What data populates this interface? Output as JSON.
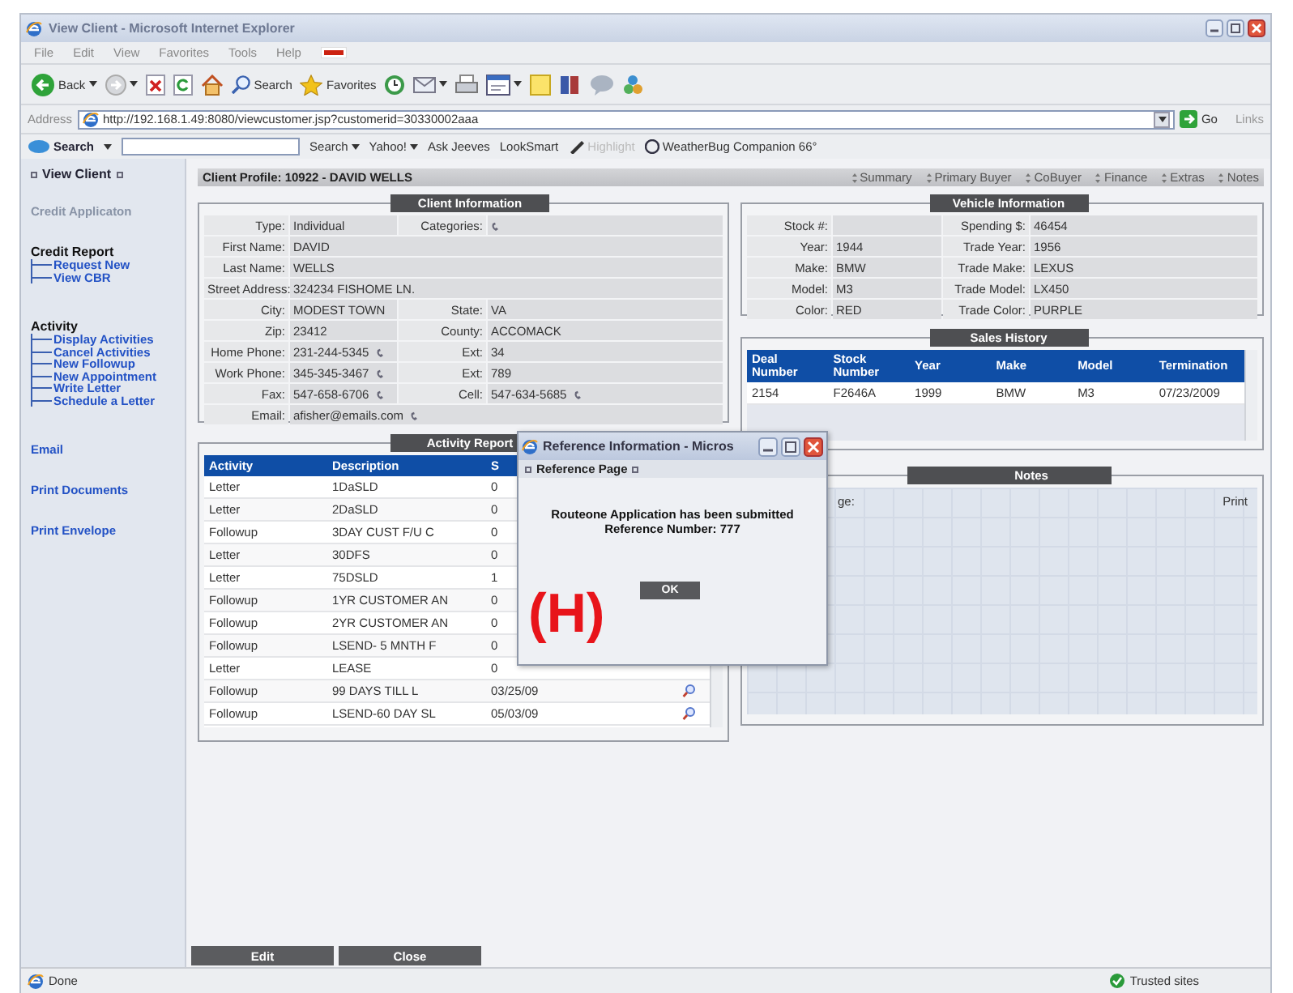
{
  "browser": {
    "title": "View Client - Microsoft Internet Explorer",
    "menu": [
      "File",
      "Edit",
      "View",
      "Favorites",
      "Tools",
      "Help"
    ],
    "toolbar": [
      {
        "kind": "back",
        "label": "Back",
        "dropdown": true
      },
      {
        "kind": "forward",
        "dropdown": true
      },
      {
        "kind": "stop",
        "dropdown": false
      },
      {
        "kind": "refresh",
        "dropdown": false
      },
      {
        "kind": "home",
        "dropdown": false
      },
      {
        "kind": "search",
        "label": "Search",
        "dropdown": false
      },
      {
        "kind": "favorites",
        "label": "Favorites",
        "dropdown": false
      },
      {
        "kind": "history",
        "dropdown": false
      },
      {
        "kind": "mail",
        "dropdown": true
      },
      {
        "kind": "print",
        "dropdown": false
      },
      {
        "kind": "edit",
        "dropdown": true
      },
      {
        "kind": "note",
        "dropdown": false
      },
      {
        "kind": "research",
        "dropdown": false
      },
      {
        "kind": "messenger",
        "dropdown": false
      },
      {
        "kind": "tool",
        "dropdown": false
      }
    ],
    "address_label": "Address",
    "url": "http://192.168.1.49:8080/viewcustomer.jsp?customerid=30330002aaa",
    "go": "Go",
    "links": "Links",
    "search_bar": {
      "brand": "Search",
      "items": [
        {
          "kind": "plain",
          "label": "Search",
          "dropdown": true,
          "disabled": false
        },
        {
          "kind": "plain",
          "label": "Yahoo!",
          "dropdown": true,
          "disabled": false
        },
        {
          "kind": "plain",
          "label": "Ask Jeeves",
          "dropdown": false,
          "disabled": false
        },
        {
          "kind": "plain",
          "label": "LookSmart",
          "dropdown": false,
          "disabled": false
        },
        {
          "kind": "highlight",
          "label": "Highlight",
          "dropdown": false,
          "disabled": true
        },
        {
          "kind": "weather",
          "label": "WeatherBug Companion 66°",
          "dropdown": false,
          "disabled": false
        }
      ]
    }
  },
  "sidebar": {
    "title": "View Client",
    "items": [
      {
        "kind": "muted",
        "label": "Credit Applicaton"
      },
      {
        "kind": "group",
        "label": "Credit Report",
        "children": [
          {
            "label": "Request New"
          },
          {
            "label": "View CBR"
          }
        ]
      },
      {
        "kind": "group",
        "label": "Activity",
        "children": [
          {
            "label": "Display Activities"
          },
          {
            "label": "Cancel Activities"
          },
          {
            "label": "New Followup"
          },
          {
            "label": "New Appointment"
          },
          {
            "label": "Write Letter"
          },
          {
            "label": "Schedule a Letter"
          }
        ]
      },
      {
        "kind": "link",
        "label": "Email"
      },
      {
        "kind": "link",
        "label": "Print Documents"
      },
      {
        "kind": "link",
        "label": "Print Envelope"
      }
    ]
  },
  "profile": {
    "title": "Client Profile: 10922 - DAVID WELLS",
    "tabs": [
      "Summary",
      "Primary Buyer",
      "CoBuyer",
      "Finance",
      "Extras",
      "Notes"
    ]
  },
  "client_info": {
    "legend": "Client Information",
    "rows": [
      [
        {
          "label": "Type:",
          "value": "Individual",
          "icon": false
        },
        {
          "label": "Categories:",
          "icon": true
        }
      ],
      [
        {
          "label": "First Name:",
          "value": "DAVID",
          "icon": false
        }
      ],
      [
        {
          "label": "Last Name:",
          "value": "WELLS",
          "icon": false
        }
      ],
      [
        {
          "label": "Street Address:",
          "value": "324234 FISHOME LN.",
          "icon": false
        }
      ],
      [
        {
          "label": "City:",
          "value": "MODEST TOWN",
          "icon": false
        },
        {
          "label": "State:",
          "value": "VA",
          "icon": false
        }
      ],
      [
        {
          "label": "Zip:",
          "value": "23412",
          "icon": false
        },
        {
          "label": "County:",
          "value": "ACCOMACK",
          "icon": false
        }
      ],
      [
        {
          "label": "Home Phone:",
          "value": "231-244-5345",
          "icon": true
        },
        {
          "label": "Ext:",
          "value": "34",
          "icon": false
        }
      ],
      [
        {
          "label": "Work Phone:",
          "value": "345-345-3467",
          "icon": true
        },
        {
          "label": "Ext:",
          "value": "789",
          "icon": false
        }
      ],
      [
        {
          "label": "Fax:",
          "value": "547-658-6706",
          "icon": true
        },
        {
          "label": "Cell:",
          "value": "547-634-5685",
          "icon": true
        }
      ],
      [
        {
          "label": "Email:",
          "value": "afisher@emails.com",
          "icon": true
        }
      ]
    ]
  },
  "vehicle_info": {
    "legend": "Vehicle Information",
    "rows": [
      [
        {
          "label": "Stock #:"
        },
        {
          "label": "Spending $:",
          "value": "46454"
        }
      ],
      [
        {
          "label": "Year:",
          "value": "1944"
        },
        {
          "label": "Trade Year:",
          "value": "1956"
        }
      ],
      [
        {
          "label": "Make:",
          "value": "BMW"
        },
        {
          "label": "Trade Make:",
          "value": "LEXUS"
        }
      ],
      [
        {
          "label": "Model:",
          "value": "M3"
        },
        {
          "label": "Trade Model:",
          "value": "LX450"
        }
      ],
      [
        {
          "label": "Color:",
          "value": "RED"
        },
        {
          "label": "Trade Color:",
          "value": "PURPLE"
        }
      ]
    ]
  },
  "sales_history": {
    "legend": "Sales History",
    "columns": [
      "Deal Number",
      "Stock Number",
      "Year",
      "Make",
      "Model",
      "Termination"
    ],
    "rows": [
      [
        "2154",
        "F2646A",
        "1999",
        "BMW",
        "M3",
        "07/23/2009"
      ]
    ]
  },
  "activity_report": {
    "legend": "Activity Report",
    "columns": [
      "Activity",
      "Description",
      "S"
    ],
    "rows": [
      {
        "cells": [
          "Letter",
          "1DaSLD",
          "0"
        ]
      },
      {
        "cells": [
          "Letter",
          "2DaSLD",
          "0"
        ]
      },
      {
        "cells": [
          "Followup",
          "3DAY CUST F/U C",
          "0"
        ]
      },
      {
        "cells": [
          "Letter",
          "30DFS",
          "0"
        ]
      },
      {
        "cells": [
          "Letter",
          "75DSLD",
          "1"
        ]
      },
      {
        "cells": [
          "Followup",
          "1YR CUSTOMER AN",
          "0"
        ]
      },
      {
        "cells": [
          "Followup",
          "2YR CUSTOMER AN",
          "0"
        ]
      },
      {
        "cells": [
          "Followup",
          "LSEND- 5 MNTH F",
          "0"
        ]
      },
      {
        "cells": [
          "Letter",
          "LEASE",
          "0"
        ]
      },
      {
        "cells": [
          "Followup",
          "99 DAYS TILL L",
          "03/25/09"
        ],
        "icon": true
      },
      {
        "cells": [
          "Followup",
          "LSEND-60 DAY SL",
          "05/03/09"
        ],
        "icon": true
      }
    ]
  },
  "notes": {
    "legend": "Notes",
    "label": "ge:",
    "print": "Print"
  },
  "buttons": [
    "Edit",
    "Close"
  ],
  "dialog": {
    "title": "Reference Information - Micros",
    "header": "Reference Page",
    "message": "Routeone Application has been submitted",
    "reference": "Reference Number: 777",
    "ok": "OK"
  },
  "annotation": "(H)",
  "status_bar": {
    "left": "Done",
    "right": "Trusted sites"
  }
}
